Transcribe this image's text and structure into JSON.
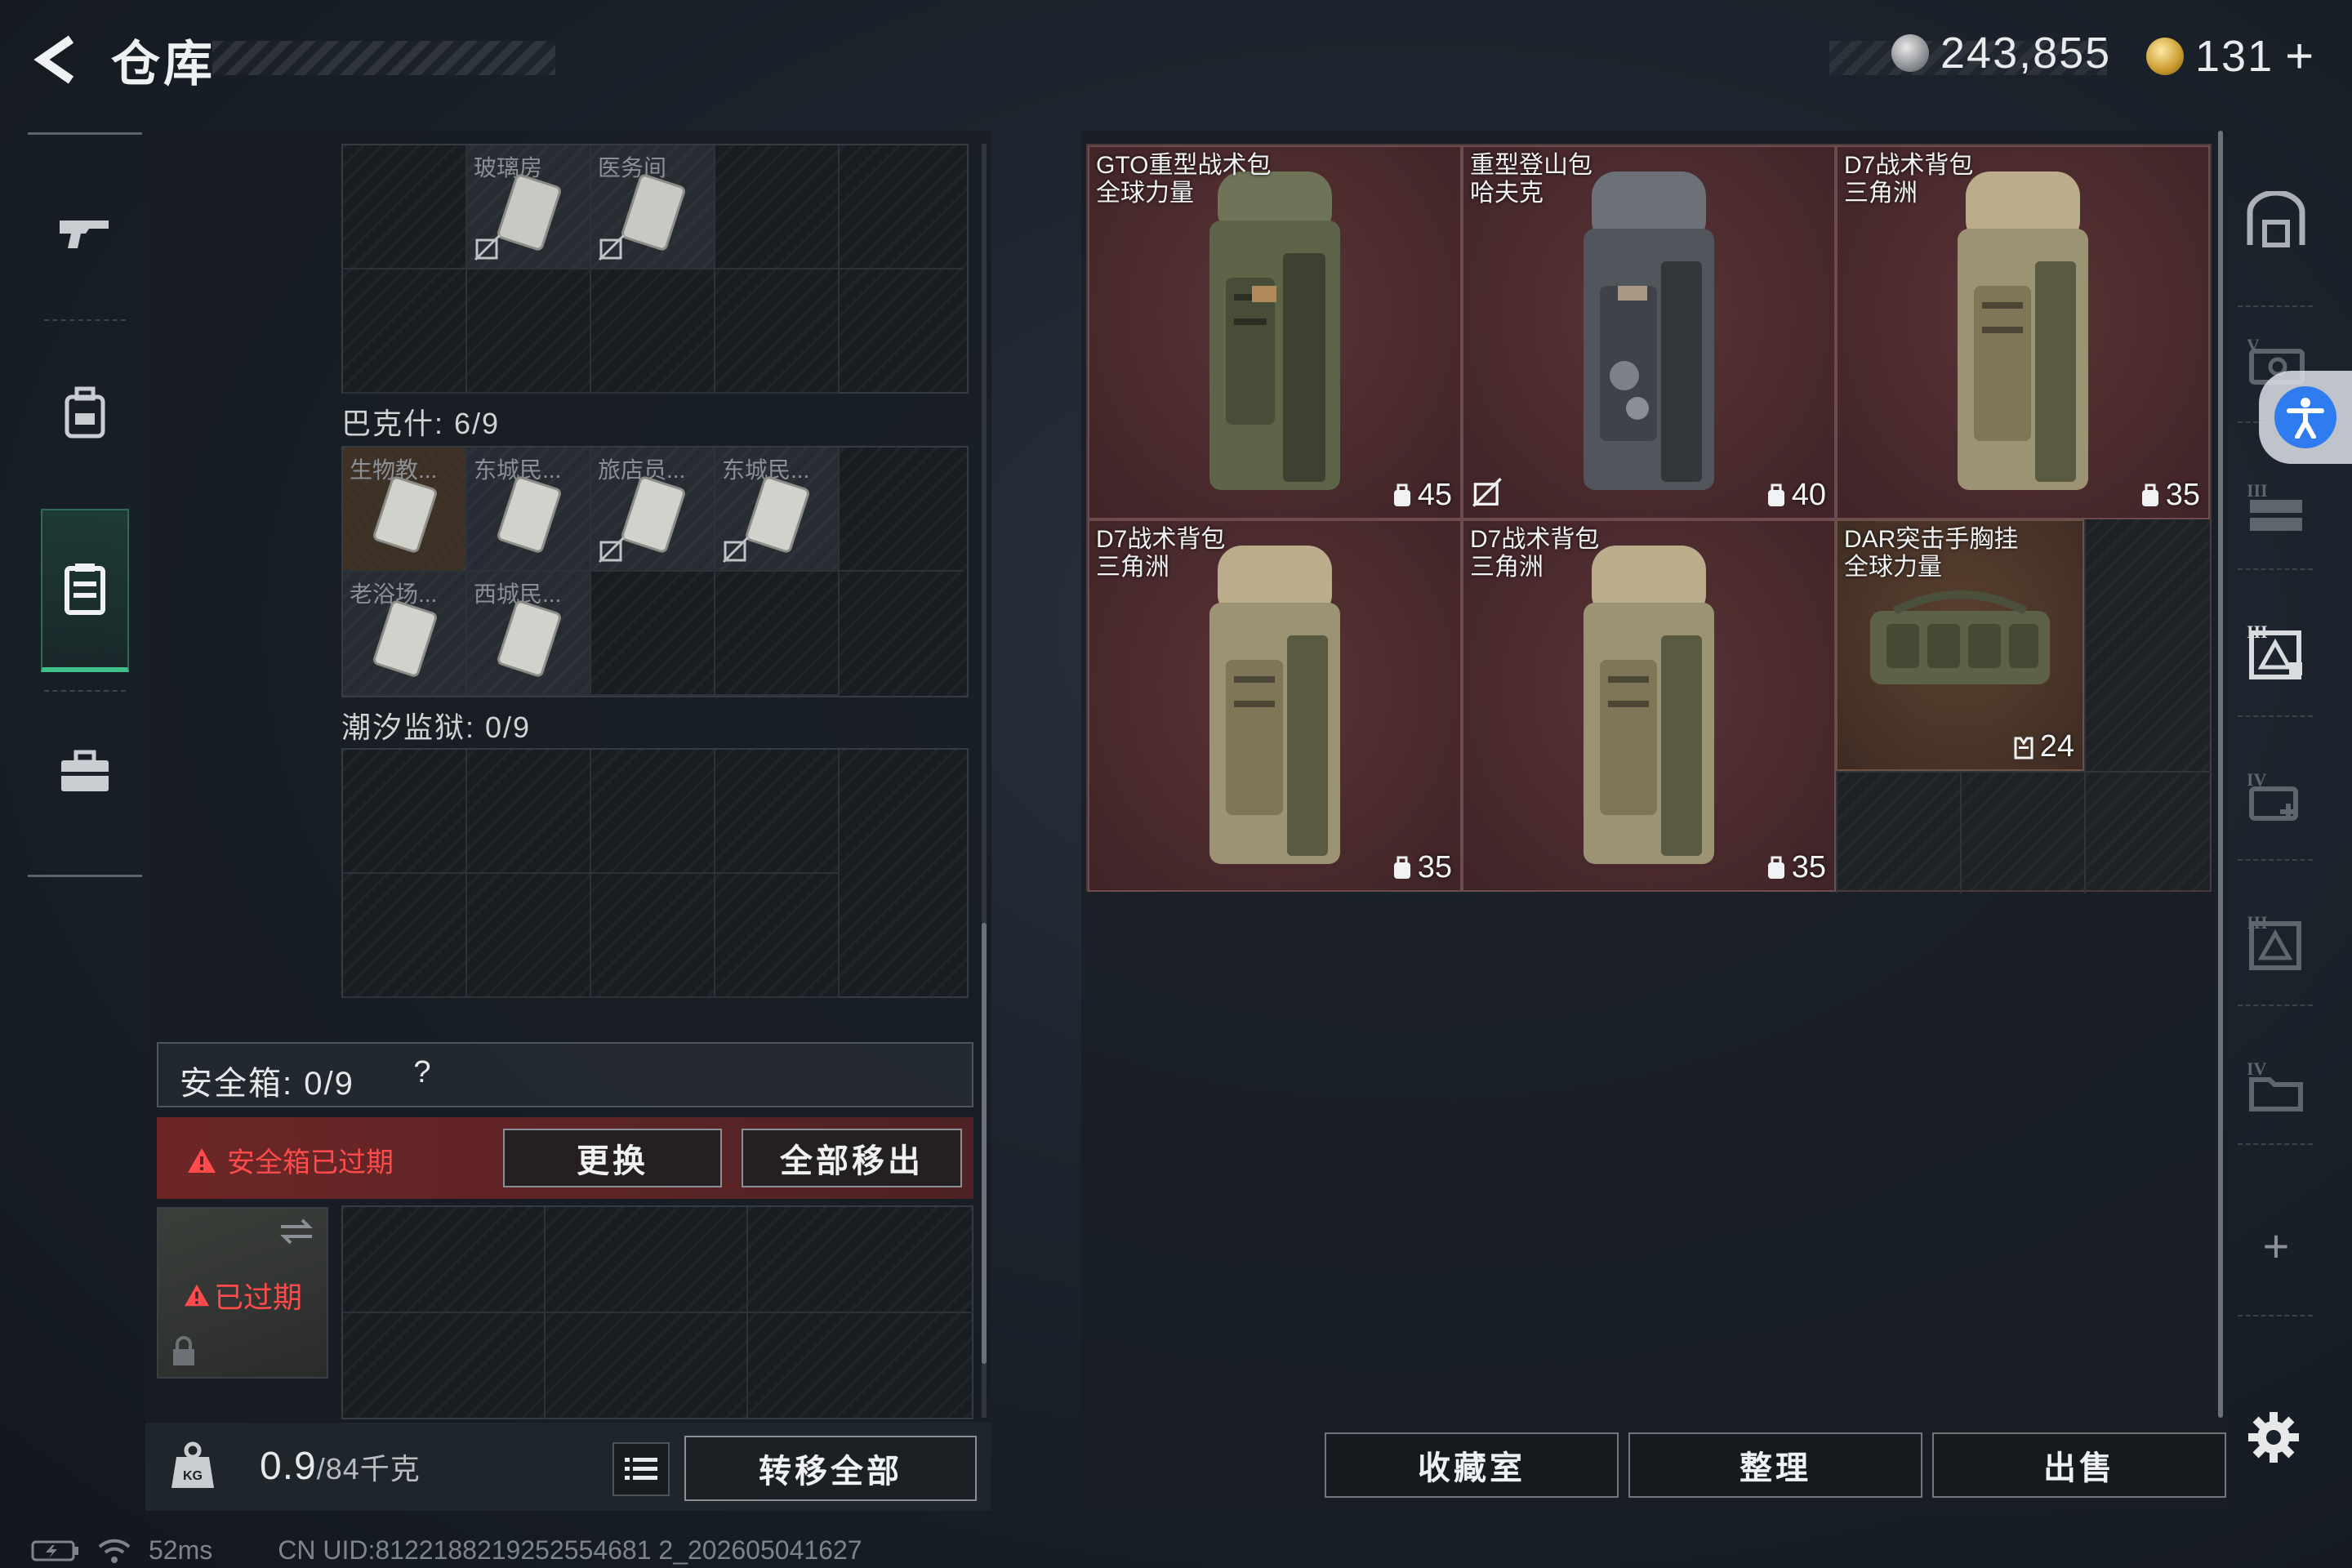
{
  "header": {
    "title": "仓库",
    "silver_amount": "243,855",
    "gold_amount": "131",
    "gold_plus": "+"
  },
  "left_nav": {
    "items": [
      {
        "icon": "gun-icon",
        "active": false
      },
      {
        "icon": "backpack-icon",
        "active": false
      },
      {
        "icon": "container-icon",
        "active": true
      },
      {
        "icon": "toolbox-icon",
        "active": false
      }
    ]
  },
  "keycards": {
    "top_cells": [
      {
        "label": "玻璃房",
        "no_transfer": true
      },
      {
        "label": "医务间",
        "no_transfer": true
      }
    ],
    "bakash": {
      "label": "巴克什: 6/9",
      "cells": [
        {
          "label": "生物教...",
          "no_transfer": false,
          "orange": true
        },
        {
          "label": "东城民...",
          "no_transfer": false,
          "orange": false
        },
        {
          "label": "旅店员...",
          "no_transfer": true,
          "orange": false
        },
        {
          "label": "东城民...",
          "no_transfer": true,
          "orange": false
        },
        {
          "label": "老浴场...",
          "no_transfer": false,
          "orange": false
        },
        {
          "label": "西城民...",
          "no_transfer": false,
          "orange": false
        }
      ]
    },
    "tidal_prison": {
      "label": "潮汐监狱: 0/9"
    }
  },
  "safe_box": {
    "title": "安全箱: 0/9",
    "help": "?",
    "expired_warning": "安全箱已过期",
    "replace_button": "更换",
    "remove_all_button": "全部移出",
    "thumb_status": "已过期"
  },
  "bottom_left": {
    "weight_value": "0.9",
    "weight_total": "/84千克",
    "transfer_all_button": "转移全部"
  },
  "stash_items": [
    {
      "name": "GTO重型战术包\n全球力量",
      "capacity": "45",
      "color": "olive",
      "no_transfer": false
    },
    {
      "name": "重型登山包\n哈夫克",
      "capacity": "40",
      "color": "grey",
      "no_transfer": true
    },
    {
      "name": "D7战术背包\n三角洲",
      "capacity": "35",
      "color": "tan",
      "no_transfer": false
    },
    {
      "name": "D7战术背包\n三角洲",
      "capacity": "35",
      "color": "tan",
      "no_transfer": false
    },
    {
      "name": "D7战术背包\n三角洲",
      "capacity": "35",
      "color": "tan",
      "no_transfer": false
    },
    {
      "name": "DAR突击手胸挂\n全球力量",
      "capacity": "24",
      "color": "olive",
      "no_transfer": false
    }
  ],
  "bottom_right": {
    "collection_button": "收藏室",
    "sort_button": "整理",
    "sell_button": "出售"
  },
  "right_nav": {
    "items": [
      "stash-tab-icon",
      "tier5-case-icon",
      "tier3-rack-icon",
      "tier3-pouch-icon",
      "tier4-medical-icon",
      "tier3-ammo-icon",
      "tier4-folder-icon"
    ],
    "add": "+"
  },
  "status_bar": {
    "ping": "52ms",
    "uid": "CN UID:8122188219252554681 2_202605041627"
  },
  "colors": {
    "accent_green": "#3fc28b",
    "warning_red": "#ff4b4b",
    "item_red_bg": "#4a2a2d",
    "access_blue": "#2f7cf0"
  }
}
